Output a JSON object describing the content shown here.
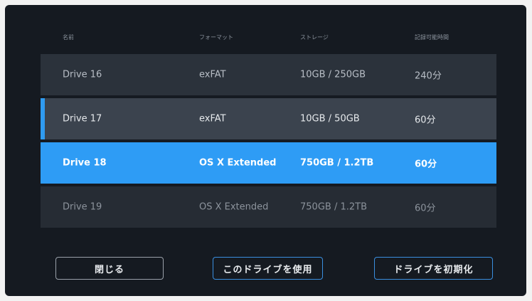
{
  "header": {
    "name": "名前",
    "format": "フォーマット",
    "storage": "ストレージ",
    "time": "記録可能時間"
  },
  "drives": [
    {
      "name": "Drive 16",
      "format": "exFAT",
      "storage": "10GB / 250GB",
      "time": "240分",
      "state": "normal"
    },
    {
      "name": "Drive 17",
      "format": "exFAT",
      "storage": "10GB / 50GB",
      "time": "60分",
      "state": "current"
    },
    {
      "name": "Drive 18",
      "format": "OS X Extended",
      "storage": "750GB / 1.2TB",
      "time": "60分",
      "state": "selected"
    },
    {
      "name": "Drive 19",
      "format": "OS X Extended",
      "storage": "750GB / 1.2TB",
      "time": "60分",
      "state": "dim"
    }
  ],
  "buttons": {
    "close": "閉じる",
    "use_drive": "このドライブを使用",
    "format_drive": "ドライブを初期化"
  },
  "colors": {
    "accent": "#2e9cf5",
    "background": "#151a21",
    "row": "#2b323b"
  }
}
